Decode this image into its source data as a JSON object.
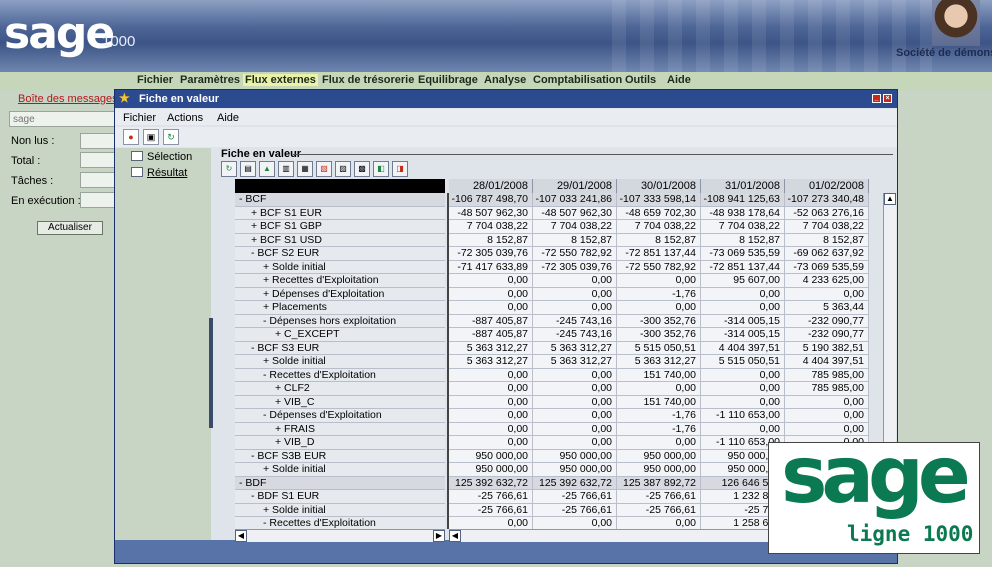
{
  "app": {
    "logo_word": "sage",
    "logo_number": "1000",
    "company": "Société de démons"
  },
  "menubar": {
    "items": [
      "Fichier",
      "Paramètres",
      "Flux externes",
      "Flux de trésorerie",
      "Equilibrage",
      "Analyse",
      "Comptabilisation",
      "Outils",
      "Aide"
    ],
    "active": "Flux externes"
  },
  "leftpane": {
    "messages_link": "Boîte des messages",
    "search_placeholder": "sage",
    "stats": [
      {
        "label": "Non lus :"
      },
      {
        "label": "Total :"
      },
      {
        "label": "Tâches :"
      },
      {
        "label": "En exécution :"
      }
    ],
    "refresh_button": "Actualiser"
  },
  "window": {
    "title": "Fiche en valeur",
    "menu": [
      "Fichier",
      "Actions",
      "Aide"
    ],
    "nav": [
      "Sélection",
      "Résultat"
    ],
    "content_title": "Fiche en valeur"
  },
  "grid": {
    "dates": [
      "28/01/2008",
      "29/01/2008",
      "30/01/2008",
      "31/01/2008",
      "01/02/2008"
    ],
    "rows": [
      {
        "label": "- BCF",
        "indent": 0,
        "group": true,
        "values": [
          "-106 787 498,70",
          "-107 033 241,86",
          "-107 333 598,14",
          "-108 941 125,63",
          "-107 273 340,48"
        ]
      },
      {
        "label": "+ BCF S1 EUR",
        "indent": 1,
        "group": false,
        "values": [
          "-48 507 962,30",
          "-48 507 962,30",
          "-48 659 702,30",
          "-48 938 178,64",
          "-52 063 276,16"
        ]
      },
      {
        "label": "+ BCF S1 GBP",
        "indent": 1,
        "group": false,
        "values": [
          "7 704 038,22",
          "7 704 038,22",
          "7 704 038,22",
          "7 704 038,22",
          "7 704 038,22"
        ]
      },
      {
        "label": "+ BCF S1 USD",
        "indent": 1,
        "group": false,
        "values": [
          "8 152,87",
          "8 152,87",
          "8 152,87",
          "8 152,87",
          "8 152,87"
        ]
      },
      {
        "label": "- BCF S2 EUR",
        "indent": 1,
        "group": false,
        "values": [
          "-72 305 039,76",
          "-72 550 782,92",
          "-72 851 137,44",
          "-73 069 535,59",
          "-69 062 637,92"
        ]
      },
      {
        "label": "+ Solde initial",
        "indent": 2,
        "group": false,
        "values": [
          "-71 417 633,89",
          "-72 305 039,76",
          "-72 550 782,92",
          "-72 851 137,44",
          "-73 069 535,59"
        ]
      },
      {
        "label": "+ Recettes d'Exploitation",
        "indent": 2,
        "group": false,
        "values": [
          "0,00",
          "0,00",
          "0,00",
          "95 607,00",
          "4 233 625,00"
        ]
      },
      {
        "label": "+ Dépenses d'Exploitation",
        "indent": 2,
        "group": false,
        "values": [
          "0,00",
          "0,00",
          "-1,76",
          "0,00",
          "0,00"
        ]
      },
      {
        "label": "+ Placements",
        "indent": 2,
        "group": false,
        "values": [
          "0,00",
          "0,00",
          "0,00",
          "0,00",
          "5 363,44"
        ]
      },
      {
        "label": "- Dépenses hors exploitation",
        "indent": 2,
        "group": false,
        "values": [
          "-887 405,87",
          "-245 743,16",
          "-300 352,76",
          "-314 005,15",
          "-232 090,77"
        ]
      },
      {
        "label": "+ C_EXCEPT",
        "indent": 3,
        "group": false,
        "values": [
          "-887 405,87",
          "-245 743,16",
          "-300 352,76",
          "-314 005,15",
          "-232 090,77"
        ]
      },
      {
        "label": "- BCF S3 EUR",
        "indent": 1,
        "group": false,
        "values": [
          "5 363 312,27",
          "5 363 312,27",
          "5 515 050,51",
          "4 404 397,51",
          "5 190 382,51"
        ]
      },
      {
        "label": "+ Solde initial",
        "indent": 2,
        "group": false,
        "values": [
          "5 363 312,27",
          "5 363 312,27",
          "5 363 312,27",
          "5 515 050,51",
          "4 404 397,51"
        ]
      },
      {
        "label": "- Recettes d'Exploitation",
        "indent": 2,
        "group": false,
        "values": [
          "0,00",
          "0,00",
          "151 740,00",
          "0,00",
          "785 985,00"
        ]
      },
      {
        "label": "+ CLF2",
        "indent": 3,
        "group": false,
        "values": [
          "0,00",
          "0,00",
          "0,00",
          "0,00",
          "785 985,00"
        ]
      },
      {
        "label": "+ VIB_C",
        "indent": 3,
        "group": false,
        "values": [
          "0,00",
          "0,00",
          "151 740,00",
          "0,00",
          "0,00"
        ]
      },
      {
        "label": "- Dépenses d'Exploitation",
        "indent": 2,
        "group": false,
        "values": [
          "0,00",
          "0,00",
          "-1,76",
          "-1 110 653,00",
          "0,00"
        ]
      },
      {
        "label": "+ FRAIS",
        "indent": 3,
        "group": false,
        "values": [
          "0,00",
          "0,00",
          "-1,76",
          "0,00",
          "0,00"
        ]
      },
      {
        "label": "+ VIB_D",
        "indent": 3,
        "group": false,
        "values": [
          "0,00",
          "0,00",
          "0,00",
          "-1 110 653,00",
          "0,00"
        ]
      },
      {
        "label": "- BCF S3B EUR",
        "indent": 1,
        "group": false,
        "values": [
          "950 000,00",
          "950 000,00",
          "950 000,00",
          "950 000,00",
          ""
        ]
      },
      {
        "label": "+ Solde initial",
        "indent": 2,
        "group": false,
        "values": [
          "950 000,00",
          "950 000,00",
          "950 000,00",
          "950 000,00",
          ""
        ]
      },
      {
        "label": "- BDF",
        "indent": 0,
        "group": true,
        "values": [
          "125 392 632,72",
          "125 392 632,72",
          "125 387 892,72",
          "126 646 513",
          ""
        ]
      },
      {
        "label": "- BDF S1 EUR",
        "indent": 1,
        "group": false,
        "values": [
          "-25 766,61",
          "-25 766,61",
          "-25 766,61",
          "1 232 854",
          ""
        ]
      },
      {
        "label": "+ Solde initial",
        "indent": 2,
        "group": false,
        "values": [
          "-25 766,61",
          "-25 766,61",
          "-25 766,61",
          "-25 766",
          ""
        ]
      },
      {
        "label": "- Recettes d'Exploitation",
        "indent": 2,
        "group": false,
        "values": [
          "0,00",
          "0,00",
          "0,00",
          "1 258 621",
          ""
        ]
      }
    ]
  },
  "brand": {
    "word": "sage",
    "tagline": "ligne 1000",
    "color": "#0b7a52"
  }
}
